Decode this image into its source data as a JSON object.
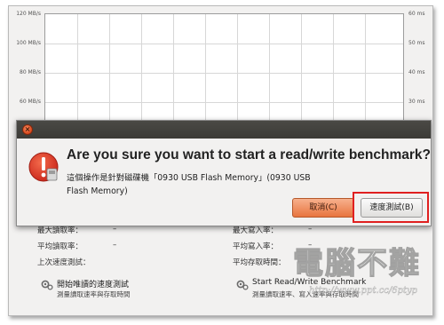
{
  "graph": {
    "left_axis": [
      "120 MB/s",
      "100 MB/s",
      "80 MB/s",
      "60 MB/s"
    ],
    "right_axis": [
      "60 ms",
      "50 ms",
      "40 ms",
      "30 ms"
    ]
  },
  "dialog": {
    "heading": "Are you sure you want to start a read/write benchmark?",
    "message": "這個操作是針對磁碟機「0930 USB Flash Memory」(0930 USB Flash Memory)",
    "cancel_label": "取消(C)",
    "start_label": "速度測試(B)",
    "close_glyph": "×"
  },
  "stats": {
    "max_read_label": "最大讀取率：",
    "max_read_value": "–",
    "avg_read_label": "平均讀取率：",
    "avg_read_value": "–",
    "last_test_label": "上次速度測試：",
    "max_write_label": "最大寫入率：",
    "max_write_value": "–",
    "avg_write_label": "平均寫入率：",
    "avg_write_value": "–",
    "avg_access_label": "平均存取時間："
  },
  "actions": {
    "readonly_title": "開始唯讀的速度測試",
    "readonly_desc": "測量讀取速率與存取時間",
    "rw_title": "Start Read/Write Benchmark",
    "rw_desc": "測量讀取速率、寫入速率與存取時間"
  },
  "watermark": {
    "text": "電腦不難",
    "url": "http://www.ppt.cc/6ptyp"
  },
  "colors": {
    "cancel_button": "#e8743f",
    "highlight_box": "#e02020",
    "warning_icon": "#e23a1e"
  }
}
